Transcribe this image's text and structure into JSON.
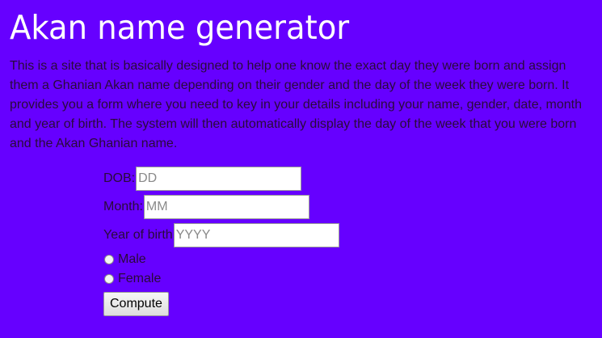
{
  "header": {
    "title": "Akan name generator"
  },
  "intro": {
    "text": "This is a site that is basically designed to help one know the exact day they were born and assign them a Ghanian Akan name depending on their gender and the day of the week they were born. It provides you a form where you need to key in your details including your name, gender, date, month and year of birth. The system will then automatically display the day of the week that you were born and the Akan Ghanian name."
  },
  "form": {
    "dob_label": "DOB:",
    "dob_placeholder": "DD",
    "month_label": "Month:",
    "month_placeholder": "MM",
    "year_label": "Year of birth",
    "year_placeholder": "YYYY",
    "gender_options": [
      "Male",
      "Female"
    ],
    "compute_label": "Compute"
  },
  "colors": {
    "background": "#6600ff",
    "title": "#ffffff",
    "text": "#2a0a3a"
  }
}
